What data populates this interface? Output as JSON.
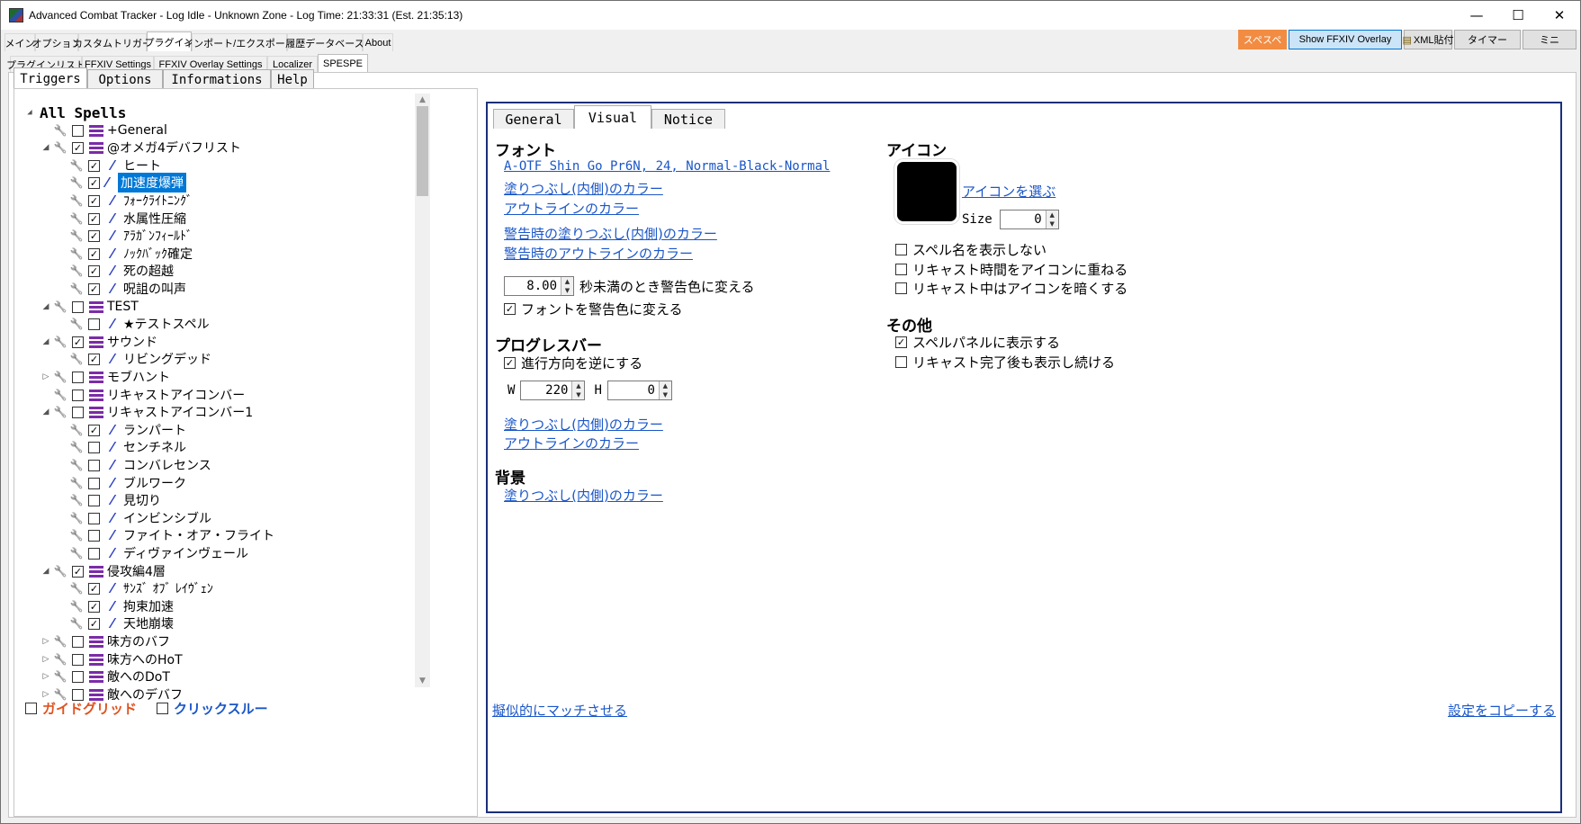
{
  "window": {
    "title": "Advanced Combat Tracker - Log Idle - Unknown Zone - Log Time: 21:33:31 (Est. 21:35:13)",
    "minimize": "—",
    "maximize": "☐",
    "close": "✕"
  },
  "menu": {
    "tabs": [
      "メイン",
      "オプション",
      "カスタムトリガー",
      "プラグイン",
      "インポート/エクスポート",
      "履歴データベース",
      "About"
    ]
  },
  "top_buttons": {
    "spespe": "スペスペ",
    "show_overlay": "Show FFXIV Overlay",
    "xml": "XML貼付",
    "timer": "タイマー",
    "mini": "ミニ"
  },
  "plugin_tabs": [
    "プラグインリスト",
    "FFXIV Settings",
    "FFXIV Overlay Settings",
    "Localizer",
    "SPESPE"
  ],
  "section_tabs": [
    "Triggers",
    "Options",
    "Informations",
    "Help"
  ],
  "tree": {
    "root": "All Spells",
    "items": [
      {
        "label": "+General",
        "checked": false,
        "type": "group",
        "exp": ""
      },
      {
        "label": "@オメガ4デバフリスト",
        "checked": true,
        "type": "group",
        "exp": "◢"
      },
      {
        "label": "ヒート",
        "checked": true,
        "type": "spell",
        "exp": ""
      },
      {
        "label": "加速度爆弾",
        "checked": true,
        "type": "spell",
        "exp": "",
        "selected": true
      },
      {
        "label": "ﾌｫｰｸﾗｲﾄﾆﾝｸﾞ",
        "checked": true,
        "type": "spell",
        "exp": ""
      },
      {
        "label": "水属性圧縮",
        "checked": true,
        "type": "spell",
        "exp": ""
      },
      {
        "label": "ｱﾗｶﾞﾝﾌｨｰﾙﾄﾞ",
        "checked": true,
        "type": "spell",
        "exp": ""
      },
      {
        "label": "ﾉｯｸﾊﾞｯｸ確定",
        "checked": true,
        "type": "spell",
        "exp": ""
      },
      {
        "label": "死の超越",
        "checked": true,
        "type": "spell",
        "exp": ""
      },
      {
        "label": "呪詛の叫声",
        "checked": true,
        "type": "spell",
        "exp": ""
      },
      {
        "label": "TEST",
        "checked": false,
        "type": "group",
        "exp": "◢"
      },
      {
        "label": "★テストスペル",
        "checked": false,
        "type": "spell",
        "exp": ""
      },
      {
        "label": "サウンド",
        "checked": true,
        "type": "group",
        "exp": "◢"
      },
      {
        "label": "リビングデッド",
        "checked": true,
        "type": "spell",
        "exp": ""
      },
      {
        "label": "モブハント",
        "checked": false,
        "type": "group",
        "exp": "▷"
      },
      {
        "label": "リキャストアイコンバー",
        "checked": false,
        "type": "group",
        "exp": ""
      },
      {
        "label": "リキャストアイコンバー1",
        "checked": false,
        "type": "group",
        "exp": "◢"
      },
      {
        "label": "ランパート",
        "checked": true,
        "type": "spell",
        "exp": ""
      },
      {
        "label": "センチネル",
        "checked": false,
        "type": "spell",
        "exp": ""
      },
      {
        "label": "コンバレセンス",
        "checked": false,
        "type": "spell",
        "exp": ""
      },
      {
        "label": "ブルワーク",
        "checked": false,
        "type": "spell",
        "exp": ""
      },
      {
        "label": "見切り",
        "checked": false,
        "type": "spell",
        "exp": ""
      },
      {
        "label": "インビンシブル",
        "checked": false,
        "type": "spell",
        "exp": ""
      },
      {
        "label": "ファイト・オア・フライト",
        "checked": false,
        "type": "spell",
        "exp": ""
      },
      {
        "label": "ディヴァインヴェール",
        "checked": false,
        "type": "spell",
        "exp": ""
      },
      {
        "label": "侵攻編4層",
        "checked": true,
        "type": "group",
        "exp": "◢"
      },
      {
        "label": "ｻﾝｽﾞ ｵﾌﾞ ﾚｲｳﾞｪﾝ",
        "checked": true,
        "type": "spell",
        "exp": ""
      },
      {
        "label": "拘束加速",
        "checked": true,
        "type": "spell",
        "exp": ""
      },
      {
        "label": "天地崩壊",
        "checked": true,
        "type": "spell",
        "exp": ""
      },
      {
        "label": "味方のバフ",
        "checked": false,
        "type": "group",
        "exp": "▷"
      },
      {
        "label": "味方へのHoT",
        "checked": false,
        "type": "group",
        "exp": "▷"
      },
      {
        "label": "敵へのDoT",
        "checked": false,
        "type": "group",
        "exp": "▷"
      },
      {
        "label": "敵へのデバフ",
        "checked": false,
        "type": "group",
        "exp": "▷"
      }
    ]
  },
  "left_footer": {
    "guide_grid": "ガイドグリッド",
    "click_through": "クリックスルー",
    "guide_color": "#e0521e",
    "click_color": "#1a56c8"
  },
  "right_tabs": [
    "General",
    "Visual",
    "Notice"
  ],
  "font": {
    "heading": "フォント",
    "font_link": "A-OTF Shin Go Pr6N, 24, Normal-Black-Normal",
    "fill_color": "塗りつぶし(内側)のカラー",
    "outline_color": "アウトラインのカラー",
    "warn_fill": "警告時の塗りつぶし(内側)のカラー",
    "warn_outline": "警告時のアウトラインのカラー",
    "warn_seconds": "8.00",
    "warn_label": "秒未満のとき警告色に変える",
    "font_warn": "フォントを警告色に変える",
    "font_warn_checked": true
  },
  "progress": {
    "heading": "プログレスバー",
    "reverse": "進行方向を逆にする",
    "reverse_checked": true,
    "w_label": "W",
    "w_value": "220",
    "h_label": "H",
    "h_value": "0",
    "fill_color": "塗りつぶし(内側)のカラー",
    "outline_color": "アウトラインのカラー"
  },
  "background": {
    "heading": "背景",
    "fill_color": "塗りつぶし(内側)のカラー"
  },
  "icon": {
    "heading": "アイコン",
    "choose": "アイコンを選ぶ",
    "size_label": "Size",
    "size_value": "0",
    "opts": [
      "スペル名を表示しない",
      "リキャスト時間をアイコンに重ねる",
      "リキャスト中はアイコンを暗くする"
    ]
  },
  "other": {
    "heading": "その他",
    "opts": [
      "スペルパネルに表示する",
      "リキャスト完了後も表示し続ける"
    ],
    "checked": [
      true,
      false
    ]
  },
  "footer": {
    "pseudo_match": "擬似的にマッチさせる",
    "copy_settings": "設定をコピーする"
  },
  "colors": {
    "selection": "#0078d7",
    "link": "#1a56c8",
    "panel_border": "#1a2f7a",
    "spespe_bg": "#f28c42"
  }
}
